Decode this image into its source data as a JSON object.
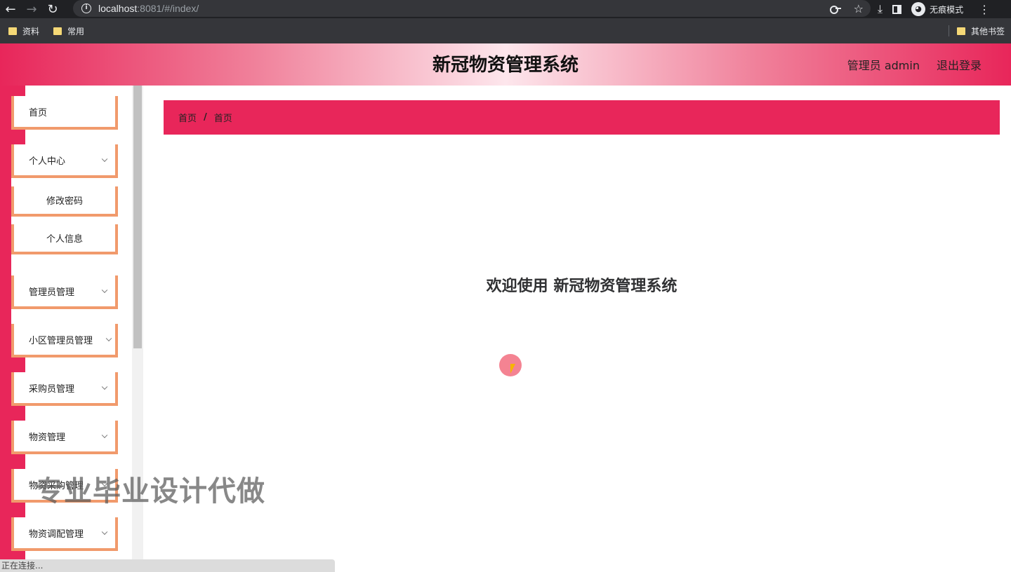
{
  "browser": {
    "url_host": "localhost",
    "url_rest": ":8081/#/index/",
    "incognito_label": "无痕模式",
    "bookmarks": [
      "资料",
      "常用"
    ],
    "other_bookmarks": "其他书签",
    "status_text": "正在连接..."
  },
  "header": {
    "title": "新冠物资管理系统",
    "user_label": "管理员 admin",
    "logout_label": "退出登录"
  },
  "sidebar": {
    "items": [
      {
        "label": "首页"
      },
      {
        "label": "个人中心"
      },
      {
        "label": "修改密码"
      },
      {
        "label": "个人信息"
      },
      {
        "label": "管理员管理"
      },
      {
        "label": "小区管理员管理"
      },
      {
        "label": "采购员管理"
      },
      {
        "label": "物资管理"
      },
      {
        "label": "物资采购管理"
      },
      {
        "label": "物资调配管理"
      }
    ]
  },
  "main": {
    "breadcrumb": [
      "首页",
      "首页"
    ],
    "breadcrumb_separator": "/",
    "welcome": "欢迎使用 新冠物资管理系统"
  },
  "overlay": {
    "watermark": "专业毕业设计代做"
  },
  "colors": {
    "accent": "#e8265a",
    "menu_border": "#f19a6c"
  }
}
